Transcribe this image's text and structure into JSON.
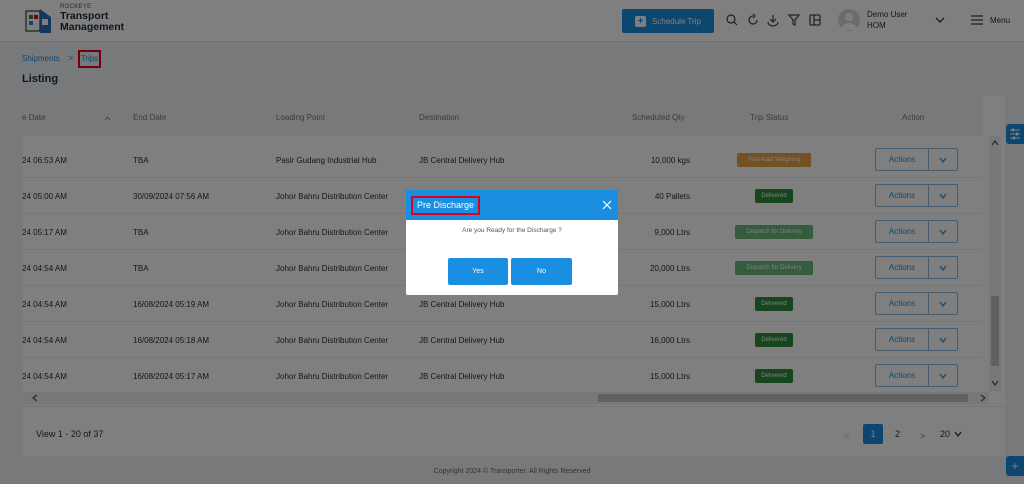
{
  "header": {
    "brand_small": "ROCKEYE",
    "brand_line1": "Transport",
    "brand_line2": "Management",
    "schedule_label": "Schedule Trip",
    "user_name": "Demo User",
    "user_org": "HOM",
    "menu_label": "Menu"
  },
  "breadcrumb": {
    "shipments": "Shipments",
    "separator": ">",
    "trips": "Trips"
  },
  "page_title": "Listing",
  "table": {
    "columns": [
      "e Date",
      "End Date",
      "Loading Point",
      "Destination",
      "Scheduled Qty",
      "Trip Status",
      "Action"
    ],
    "rows": [
      {
        "start": "24 06:53 AM",
        "end": "TBA",
        "loading": "Pasir Gudang Industrial Hub",
        "dest": "JB Central Delivery Hub",
        "qty": "10,000 kgs",
        "status": "Post-load Weighing",
        "action": "Actions"
      },
      {
        "start": "24 05:00 AM",
        "end": "30/09/2024 07:56 AM",
        "loading": "Johor Bahru Distribution Center",
        "dest": "",
        "qty": "40 Pallets",
        "status": "Delivered",
        "action": "Actions"
      },
      {
        "start": "24 05:17 AM",
        "end": "TBA",
        "loading": "Johor Bahru Distribution Center",
        "dest": "",
        "qty": "9,000 Ltrs",
        "status": "Dispatch for Delivery",
        "action": "Actions"
      },
      {
        "start": "24 04:54 AM",
        "end": "TBA",
        "loading": "Johor Bahru Distribution Center",
        "dest": "",
        "qty": "20,000 Ltrs",
        "status": "Dispatch for Delivery",
        "action": "Actions"
      },
      {
        "start": "24 04:54 AM",
        "end": "16/08/2024 05:19 AM",
        "loading": "Johor Bahru Distribution Center",
        "dest": "JB Central Delivery Hub",
        "qty": "15,000 Ltrs",
        "status": "Delivered",
        "action": "Actions"
      },
      {
        "start": "24 04:54 AM",
        "end": "16/08/2024 05:18 AM",
        "loading": "Johor Bahru Distribution Center",
        "dest": "JB Central Delivery Hub",
        "qty": "16,000 Ltrs",
        "status": "Delivered",
        "action": "Actions"
      },
      {
        "start": "24 04:54 AM",
        "end": "16/08/2024 05:17 AM",
        "loading": "Johor Bahru Distribution Center",
        "dest": "JB Central Delivery Hub",
        "qty": "15,000 Ltrs",
        "status": "Delivered",
        "action": "Actions"
      }
    ]
  },
  "pagination": {
    "view": "View 1 - 20 of 37",
    "prev": "<",
    "page1": "1",
    "page2": "2",
    "next": ">",
    "page_size": "20"
  },
  "footer": {
    "copyright": "Copyright 2024 © Transporter. All Rights Reserved"
  },
  "modal": {
    "title": "Pre Discharge",
    "message": "Are you Ready for the Discharge ?",
    "yes": "Yes",
    "no": "No"
  },
  "colors": {
    "accent": "#1a8ee0",
    "delivered": "#2e8b3a",
    "weighing": "#e8a04a",
    "dispatch": "#6ab97a",
    "highlight": "#e0001b"
  }
}
